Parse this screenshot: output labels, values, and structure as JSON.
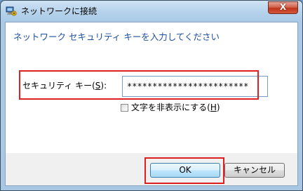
{
  "window": {
    "title": "ネットワークに接続",
    "close_label": "X"
  },
  "dialog": {
    "heading": "ネットワーク セキュリティ キーを入力してください",
    "key_label_prefix": "セキュリティ キー(",
    "key_label_access": "S",
    "key_label_suffix": "):",
    "key_value": "************************",
    "hide_chars_prefix": "文字を非表示にする(",
    "hide_chars_access": "H",
    "hide_chars_suffix": ")",
    "hide_chars_checked": false,
    "ok_label": "OK",
    "cancel_label": "キャンセル"
  },
  "colors": {
    "heading": "#1e4f9c",
    "annotation_red": "#e02020"
  },
  "icons": {
    "title": "network-connect-icon",
    "close": "close-icon"
  }
}
